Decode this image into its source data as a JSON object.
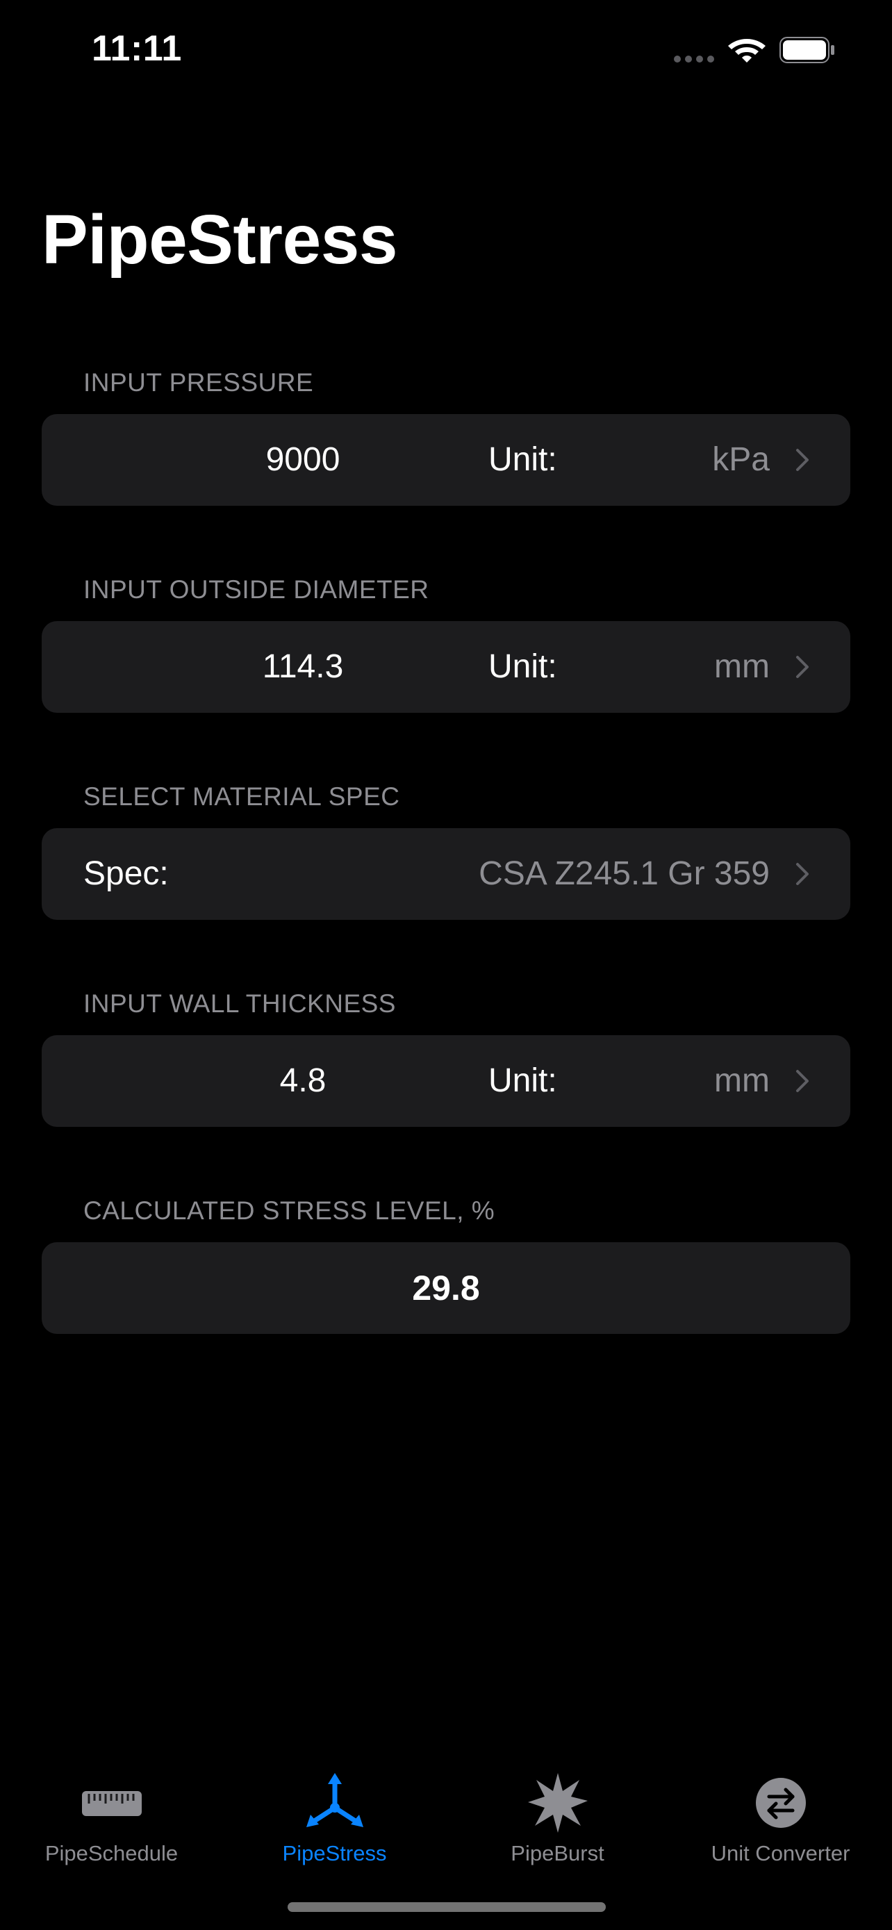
{
  "status_bar": {
    "time": "11:11"
  },
  "title": "PipeStress",
  "pressure": {
    "header": "INPUT PRESSURE",
    "value": "9000",
    "unit_label": "Unit:",
    "unit_value": "kPa"
  },
  "diameter": {
    "header": "INPUT OUTSIDE DIAMETER",
    "value": "114.3",
    "unit_label": "Unit:",
    "unit_value": "mm"
  },
  "material": {
    "header": "SELECT MATERIAL SPEC",
    "label": "Spec:",
    "value": "CSA Z245.1 Gr 359"
  },
  "wall": {
    "header": "INPUT WALL THICKNESS",
    "value": "4.8",
    "unit_label": "Unit:",
    "unit_value": "mm"
  },
  "result": {
    "header": "CALCULATED STRESS LEVEL, %",
    "value": "29.8"
  },
  "tabs": [
    {
      "label": "PipeSchedule",
      "icon": "ruler-icon",
      "active": false
    },
    {
      "label": "PipeStress",
      "icon": "stress-arrows-icon",
      "active": true
    },
    {
      "label": "PipeBurst",
      "icon": "burst-icon",
      "active": false
    },
    {
      "label": "Unit Converter",
      "icon": "convert-arrows-icon",
      "active": false
    }
  ],
  "colors": {
    "background": "#000000",
    "card": "#1c1c1e",
    "secondary_text": "#8e8e93",
    "accent": "#0a84ff"
  }
}
